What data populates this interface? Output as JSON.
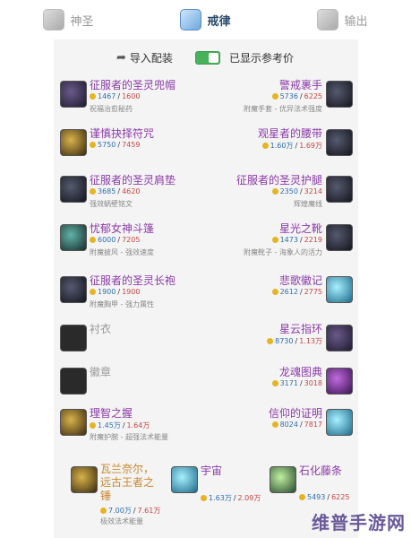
{
  "tabs": [
    {
      "label": "神圣",
      "icon": "holy-icon"
    },
    {
      "label": "戒律",
      "icon": "discipline-icon"
    },
    {
      "label": "输出",
      "icon": "damage-icon"
    }
  ],
  "toolbar": {
    "import_label": "导入配装",
    "toggle_on": true,
    "toggle_label": "已显示参考价"
  },
  "items": [
    {
      "slot": "head",
      "name": "征服者的圣灵兜帽",
      "cur": "1467",
      "max": "1600",
      "ench": "祝福治愈秘药",
      "color": "purple"
    },
    {
      "slot": "hands",
      "name": "警戒裹手",
      "cur": "5736",
      "max": "6225",
      "ench": "附魔手套 - 优异法术强度",
      "color": "purple"
    },
    {
      "slot": "neck",
      "name": "谨慎抉择符咒",
      "cur": "5750",
      "max": "7459",
      "ench": "",
      "color": "purple"
    },
    {
      "slot": "waist",
      "name": "观星者的腰带",
      "cur": "1.60万",
      "max": "1.69万",
      "ench": "",
      "color": "purple"
    },
    {
      "slot": "shoulder",
      "name": "征服者的圣灵肩垫",
      "cur": "3685",
      "max": "4620",
      "ench": "强效蜗壁铭文",
      "color": "purple"
    },
    {
      "slot": "legs",
      "name": "征服者的圣灵护腿",
      "cur": "2350",
      "max": "3214",
      "ench": "辉煌魔线",
      "color": "purple"
    },
    {
      "slot": "back",
      "name": "忧郁女神斗篷",
      "cur": "6000",
      "max": "7205",
      "ench": "附魔披风 - 强效速度",
      "color": "purple"
    },
    {
      "slot": "feet",
      "name": "星光之靴",
      "cur": "1473",
      "max": "2219",
      "ench": "附魔靴子 - 海象人的活力",
      "color": "purple"
    },
    {
      "slot": "chest",
      "name": "征服者的圣灵长袍",
      "cur": "1900",
      "max": "1900",
      "ench": "附魔胸甲 - 强力属性",
      "color": "purple"
    },
    {
      "slot": "ring1",
      "name": "悲歌徽记",
      "cur": "2612",
      "max": "2775",
      "ench": "",
      "color": "purple"
    },
    {
      "slot": "shirt",
      "name": "衬衣",
      "cur": "",
      "max": "",
      "ench": "",
      "color": "gray"
    },
    {
      "slot": "ring2",
      "name": "星云指环",
      "cur": "8730",
      "max": "1.13万",
      "ench": "",
      "color": "purple"
    },
    {
      "slot": "tabard",
      "name": "徽章",
      "cur": "",
      "max": "",
      "ench": "",
      "color": "gray"
    },
    {
      "slot": "trinket1",
      "name": "龙魂图典",
      "cur": "3171",
      "max": "3018",
      "ench": "",
      "color": "purple"
    },
    {
      "slot": "wrist",
      "name": "理智之握",
      "cur": "1.45万",
      "max": "1.64万",
      "ench": "附魔护腕 - 超强法术能量",
      "color": "purple"
    },
    {
      "slot": "trinket2",
      "name": "信仰的证明",
      "cur": "8024",
      "max": "7817",
      "ench": "",
      "color": "purple"
    }
  ],
  "weapons": [
    {
      "slot": "mainhand",
      "name": "瓦兰奈尔，远古王者之锤",
      "cur": "7.00万",
      "max": "7.61万",
      "ench": "极效法术能量",
      "color": "orange"
    },
    {
      "slot": "offhand",
      "name": "宇宙",
      "cur": "1.63万",
      "max": "2.09万",
      "ench": "",
      "color": "purple"
    },
    {
      "slot": "ranged",
      "name": "石化藤条",
      "cur": "5493",
      "max": "6225",
      "ench": "",
      "color": "purple"
    }
  ],
  "watermark": "维普手游网"
}
